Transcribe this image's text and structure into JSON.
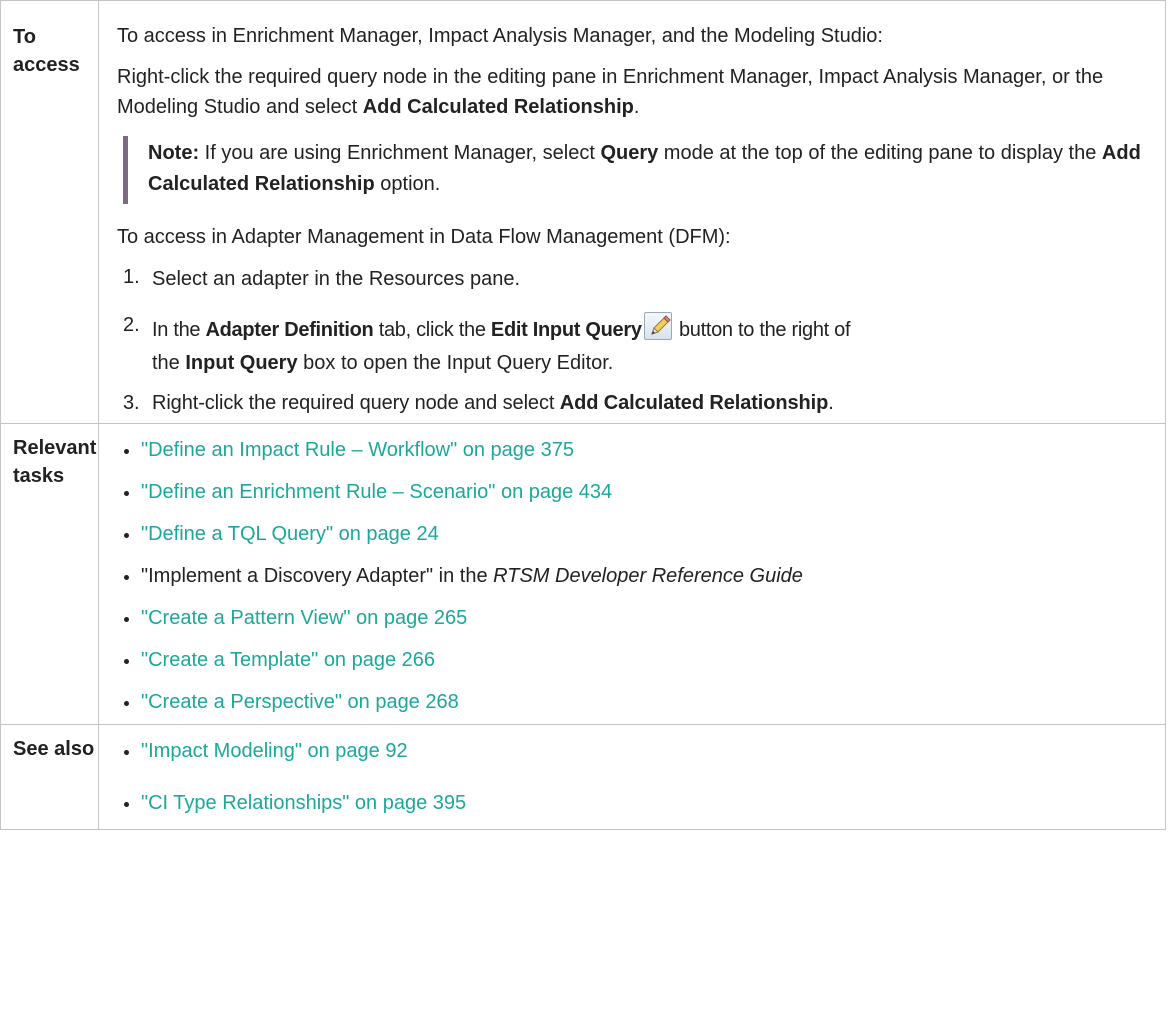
{
  "rows": {
    "access": {
      "heading": "To access",
      "intro": "To access in Enrichment Manager, Impact Analysis Manager, and the Modeling Studio:",
      "rightclick_text": "Right-click the required query node in the editing pane in Enrichment Manager, Impact Analysis Manager, or the Modeling Studio and select ",
      "rightclick_bold": "Add Calculated Relationship",
      "rightclick_end": ".",
      "note": {
        "label": "Note:",
        "text1": " If you are using Enrichment Manager, select ",
        "bold1": "Query",
        "text2": " mode at the top of the editing pane to display the ",
        "bold2": "Add Calculated Relationship",
        "text3": " option."
      },
      "dfm_intro": "To access in Adapter Management in Data Flow Management (DFM):",
      "steps": [
        {
          "num": "1.",
          "text": "Select an adapter in the Resources pane."
        },
        {
          "num": "2.",
          "a": "In the ",
          "b1": "Adapter Definition",
          "c": " tab, click the ",
          "b2": "Edit Input Query",
          "icon": "pencil-icon",
          "d": " button to the right of",
          "e": "the ",
          "b3": "Input Query",
          "f": " box to open the Input Query Editor."
        },
        {
          "num": "3.",
          "a": "Right-click the required query node and select ",
          "b": "Add Calculated Relationship",
          "c": "."
        }
      ]
    },
    "tasks": {
      "heading": "Relevant tasks",
      "items": [
        {
          "text": "\"Define an Impact Rule – Workflow\" on page 375"
        },
        {
          "text": "\"Define an Enrichment Rule – Scenario\" on page 434"
        },
        {
          "text": "\"Define a TQL Query\" on page 24"
        },
        {
          "plain": "\"Implement a Discovery Adapter\" in the ",
          "italic": "RTSM Developer Reference Guide"
        },
        {
          "text": "\"Create a Pattern View\" on page 265"
        },
        {
          "text": "\"Create a Template\" on page 266"
        },
        {
          "text": "\"Create a Perspective\" on page 268"
        }
      ]
    },
    "also": {
      "heading": "See also",
      "items": [
        {
          "text": "\"Impact Modeling\" on page 92"
        },
        {
          "text": "\"CI Type Relationships\" on page 395"
        }
      ]
    }
  },
  "colors": {
    "link": "#1ba89a",
    "note_bar": "#7b6a82",
    "border": "#c4c4c4",
    "text": "#222222"
  }
}
